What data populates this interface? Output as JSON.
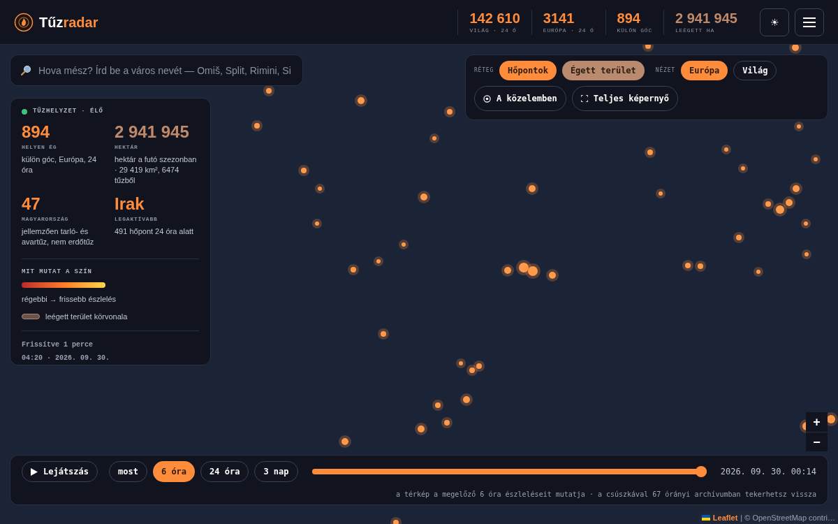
{
  "brand": {
    "part1": "Tűz",
    "part2": "radar"
  },
  "header_stats": [
    {
      "value": "142 610",
      "label": "VILÁG · 24 Ó",
      "kind": "count"
    },
    {
      "value": "3141",
      "label": "EURÓPA · 24 Ó",
      "kind": "count"
    },
    {
      "value": "894",
      "label": "KÜLÖN GÓC",
      "kind": "count"
    },
    {
      "value": "2 941 945",
      "label": "LEÉGETT HA",
      "kind": "area"
    }
  ],
  "header_buttons": {
    "theme": "☀"
  },
  "search": {
    "placeholder": "Hova mész? Írd be a város nevét — Omiš, Split, Rimini, Si"
  },
  "controls": {
    "layer_label": "RÉTEG",
    "layers": [
      {
        "label": "Hőpontok",
        "on": true,
        "kind": "hotspots"
      },
      {
        "label": "Égett terület",
        "on": true,
        "kind": "burned"
      }
    ],
    "view_label": "NÉZET",
    "views": [
      {
        "label": "Európa",
        "selected": true
      },
      {
        "label": "Világ",
        "selected": false
      }
    ],
    "actions": [
      {
        "label": "A közelemben",
        "kind": "nearby"
      },
      {
        "label": "Teljes képernyő",
        "kind": "fullscreen"
      }
    ]
  },
  "status_panel": {
    "title": "TŰZHELYZET · ÉLŐ",
    "live": true,
    "stats": [
      {
        "value": "894",
        "label": "HELYEN ÉG",
        "note": "külön góc, Európa, 24 óra",
        "kind": "count"
      },
      {
        "value": "2 941 945",
        "label": "HEKTÁR",
        "note": "hektár a futó szezonban · 29 419 km², 6474 tűzből",
        "kind": "area"
      },
      {
        "value": "47",
        "label": "MAGYARORSZÁG",
        "note": "jellemzően tarló- és avartűz, nem erdőtűz",
        "kind": "count"
      },
      {
        "value": "Irak",
        "label": "LEGAKTÍVABB",
        "note": "491 hőpont 24 óra alatt",
        "kind": "count"
      }
    ],
    "legend_title": "MIT MUTAT A SZÍN",
    "gradient_caption": "régebbi → frissebb észlelés",
    "outline_caption": "leégett terület körvonala",
    "updated": "Frissítve 1 perce",
    "timestamp": "04:20 · 2026. 09. 30."
  },
  "zoom": {
    "in": "+",
    "out": "−"
  },
  "timeline": {
    "play": "Lejátszás",
    "ranges": [
      {
        "label": "most",
        "selected": false
      },
      {
        "label": "6 óra",
        "selected": true
      },
      {
        "label": "24 óra",
        "selected": false
      },
      {
        "label": "3 nap",
        "selected": false
      }
    ],
    "level": 1,
    "time": "2026. 09. 30. 00:14",
    "caption": "a térkép a megelőző 6 óra észleléseit mutatja · a csúszkával 67 órányi archívumban tekerhetsz vissza"
  },
  "attribution": {
    "link": "Leaflet",
    "text": "| © OpenStreetMap contri…"
  }
}
